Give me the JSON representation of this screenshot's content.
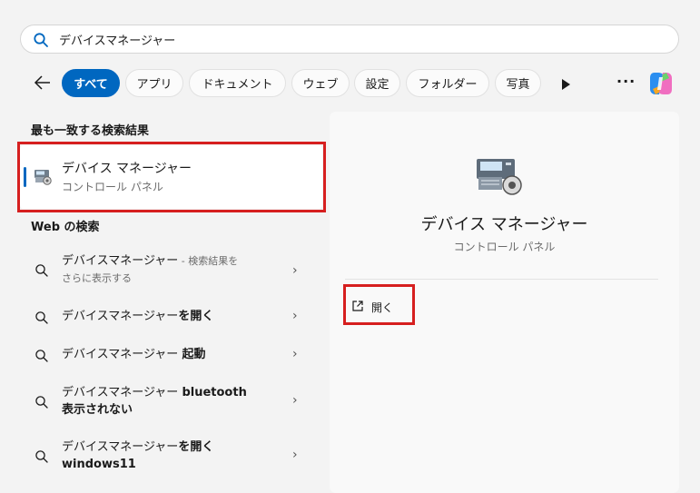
{
  "search": {
    "query": "デバイスマネージャー"
  },
  "filters": [
    {
      "label": "すべて",
      "active": true
    },
    {
      "label": "アプリ"
    },
    {
      "label": "ドキュメント"
    },
    {
      "label": "ウェブ"
    },
    {
      "label": "設定"
    },
    {
      "label": "フォルダー"
    },
    {
      "label": "写真"
    }
  ],
  "more_label": "···",
  "best_match": {
    "heading": "最も一致する検索結果",
    "title": "デバイス マネージャー",
    "subtitle": "コントロール パネル"
  },
  "web": {
    "heading": "Web の検索",
    "items": [
      {
        "text": "デバイスマネージャー",
        "suffix": " - 検索結果を",
        "line2": "さらに表示する"
      },
      {
        "text": "デバイスマネージャー",
        "bold": "を開く"
      },
      {
        "text": "デバイスマネージャー ",
        "bold": "起動"
      },
      {
        "text": "デバイスマネージャー ",
        "bold": "bluetooth",
        "line2": "表示されない"
      },
      {
        "text": "デバイスマネージャー",
        "bold": "を開く",
        "line2": "windows11"
      }
    ]
  },
  "detail": {
    "title": "デバイス マネージャー",
    "subtitle": "コントロール パネル",
    "open_label": "開く"
  },
  "colors": {
    "accent": "#0067c0",
    "highlight": "#d61f1f"
  }
}
